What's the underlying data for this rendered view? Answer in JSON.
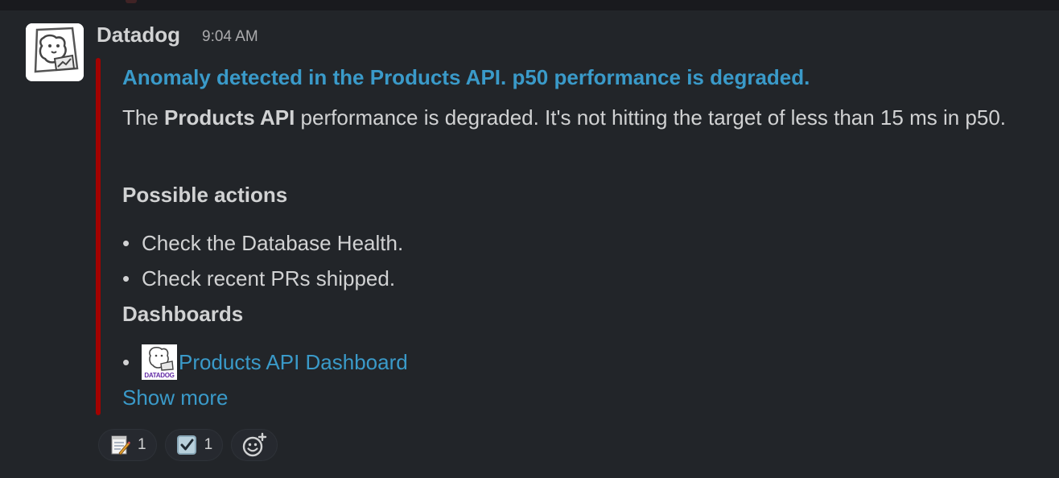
{
  "message": {
    "sender": "Datadog",
    "timestamp": "9:04 AM",
    "attachment": {
      "color": "#a30200",
      "title": "Anomaly detected in the Products API. p50 performance is degraded.",
      "body_prefix": "The ",
      "body_bold": "Products API",
      "body_suffix": " performance is degraded. It's not hitting the target of less than 15 ms in p50.",
      "actions_heading": "Possible actions",
      "actions": [
        "Check the Database Health.",
        "Check recent PRs shipped."
      ],
      "dashboards_heading": "Dashboards",
      "dashboard_logo_text": "DATADOG",
      "dashboard_link": "Products API Dashboard",
      "show_more": "Show more"
    },
    "reactions": [
      {
        "icon": "memo-icon",
        "count": "1"
      },
      {
        "icon": "ballot-box-with-check-icon",
        "count": "1"
      }
    ]
  },
  "colors": {
    "background": "#222529",
    "link": "#3a9ac9",
    "text": "#d1d2d3"
  }
}
